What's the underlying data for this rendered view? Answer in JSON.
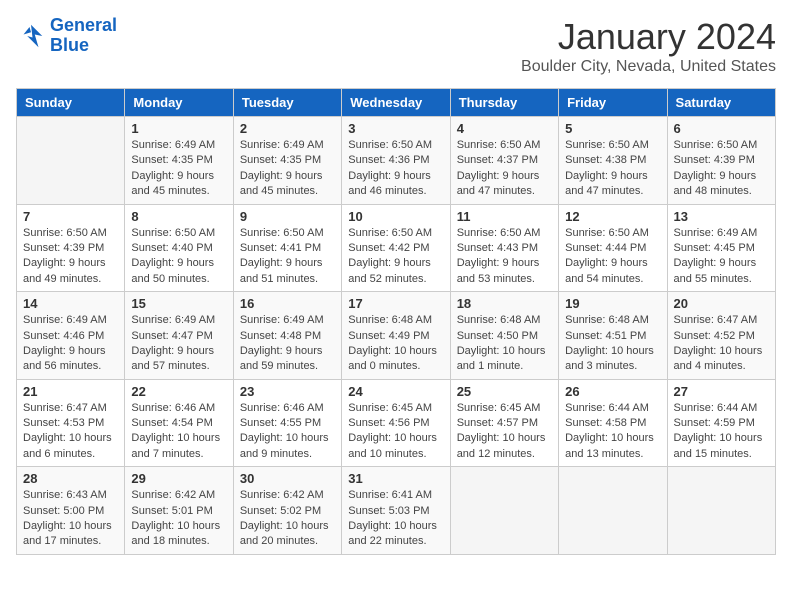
{
  "header": {
    "logo_line1": "General",
    "logo_line2": "Blue",
    "title": "January 2024",
    "subtitle": "Boulder City, Nevada, United States"
  },
  "calendar": {
    "days_of_week": [
      "Sunday",
      "Monday",
      "Tuesday",
      "Wednesday",
      "Thursday",
      "Friday",
      "Saturday"
    ],
    "weeks": [
      [
        {
          "day": "",
          "info": ""
        },
        {
          "day": "1",
          "info": "Sunrise: 6:49 AM\nSunset: 4:35 PM\nDaylight: 9 hours\nand 45 minutes."
        },
        {
          "day": "2",
          "info": "Sunrise: 6:49 AM\nSunset: 4:35 PM\nDaylight: 9 hours\nand 45 minutes."
        },
        {
          "day": "3",
          "info": "Sunrise: 6:50 AM\nSunset: 4:36 PM\nDaylight: 9 hours\nand 46 minutes."
        },
        {
          "day": "4",
          "info": "Sunrise: 6:50 AM\nSunset: 4:37 PM\nDaylight: 9 hours\nand 47 minutes."
        },
        {
          "day": "5",
          "info": "Sunrise: 6:50 AM\nSunset: 4:38 PM\nDaylight: 9 hours\nand 47 minutes."
        },
        {
          "day": "6",
          "info": "Sunrise: 6:50 AM\nSunset: 4:39 PM\nDaylight: 9 hours\nand 48 minutes."
        }
      ],
      [
        {
          "day": "7",
          "info": "Sunrise: 6:50 AM\nSunset: 4:39 PM\nDaylight: 9 hours\nand 49 minutes."
        },
        {
          "day": "8",
          "info": "Sunrise: 6:50 AM\nSunset: 4:40 PM\nDaylight: 9 hours\nand 50 minutes."
        },
        {
          "day": "9",
          "info": "Sunrise: 6:50 AM\nSunset: 4:41 PM\nDaylight: 9 hours\nand 51 minutes."
        },
        {
          "day": "10",
          "info": "Sunrise: 6:50 AM\nSunset: 4:42 PM\nDaylight: 9 hours\nand 52 minutes."
        },
        {
          "day": "11",
          "info": "Sunrise: 6:50 AM\nSunset: 4:43 PM\nDaylight: 9 hours\nand 53 minutes."
        },
        {
          "day": "12",
          "info": "Sunrise: 6:50 AM\nSunset: 4:44 PM\nDaylight: 9 hours\nand 54 minutes."
        },
        {
          "day": "13",
          "info": "Sunrise: 6:49 AM\nSunset: 4:45 PM\nDaylight: 9 hours\nand 55 minutes."
        }
      ],
      [
        {
          "day": "14",
          "info": "Sunrise: 6:49 AM\nSunset: 4:46 PM\nDaylight: 9 hours\nand 56 minutes."
        },
        {
          "day": "15",
          "info": "Sunrise: 6:49 AM\nSunset: 4:47 PM\nDaylight: 9 hours\nand 57 minutes."
        },
        {
          "day": "16",
          "info": "Sunrise: 6:49 AM\nSunset: 4:48 PM\nDaylight: 9 hours\nand 59 minutes."
        },
        {
          "day": "17",
          "info": "Sunrise: 6:48 AM\nSunset: 4:49 PM\nDaylight: 10 hours\nand 0 minutes."
        },
        {
          "day": "18",
          "info": "Sunrise: 6:48 AM\nSunset: 4:50 PM\nDaylight: 10 hours\nand 1 minute."
        },
        {
          "day": "19",
          "info": "Sunrise: 6:48 AM\nSunset: 4:51 PM\nDaylight: 10 hours\nand 3 minutes."
        },
        {
          "day": "20",
          "info": "Sunrise: 6:47 AM\nSunset: 4:52 PM\nDaylight: 10 hours\nand 4 minutes."
        }
      ],
      [
        {
          "day": "21",
          "info": "Sunrise: 6:47 AM\nSunset: 4:53 PM\nDaylight: 10 hours\nand 6 minutes."
        },
        {
          "day": "22",
          "info": "Sunrise: 6:46 AM\nSunset: 4:54 PM\nDaylight: 10 hours\nand 7 minutes."
        },
        {
          "day": "23",
          "info": "Sunrise: 6:46 AM\nSunset: 4:55 PM\nDaylight: 10 hours\nand 9 minutes."
        },
        {
          "day": "24",
          "info": "Sunrise: 6:45 AM\nSunset: 4:56 PM\nDaylight: 10 hours\nand 10 minutes."
        },
        {
          "day": "25",
          "info": "Sunrise: 6:45 AM\nSunset: 4:57 PM\nDaylight: 10 hours\nand 12 minutes."
        },
        {
          "day": "26",
          "info": "Sunrise: 6:44 AM\nSunset: 4:58 PM\nDaylight: 10 hours\nand 13 minutes."
        },
        {
          "day": "27",
          "info": "Sunrise: 6:44 AM\nSunset: 4:59 PM\nDaylight: 10 hours\nand 15 minutes."
        }
      ],
      [
        {
          "day": "28",
          "info": "Sunrise: 6:43 AM\nSunset: 5:00 PM\nDaylight: 10 hours\nand 17 minutes."
        },
        {
          "day": "29",
          "info": "Sunrise: 6:42 AM\nSunset: 5:01 PM\nDaylight: 10 hours\nand 18 minutes."
        },
        {
          "day": "30",
          "info": "Sunrise: 6:42 AM\nSunset: 5:02 PM\nDaylight: 10 hours\nand 20 minutes."
        },
        {
          "day": "31",
          "info": "Sunrise: 6:41 AM\nSunset: 5:03 PM\nDaylight: 10 hours\nand 22 minutes."
        },
        {
          "day": "",
          "info": ""
        },
        {
          "day": "",
          "info": ""
        },
        {
          "day": "",
          "info": ""
        }
      ]
    ]
  }
}
